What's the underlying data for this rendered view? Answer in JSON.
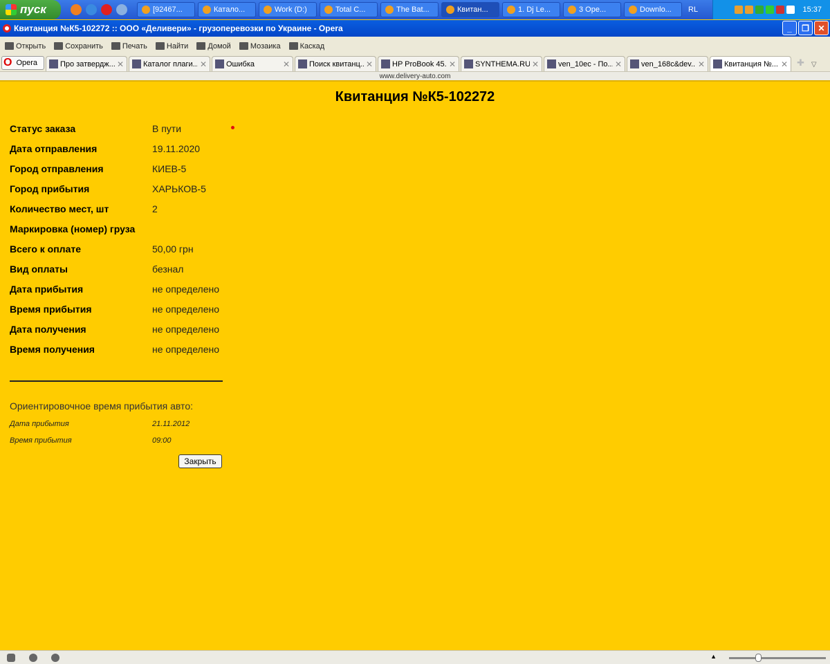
{
  "taskbar": {
    "start_label": "пуск",
    "buttons": [
      "[92467...",
      "Катало...",
      "Work (D:)",
      "Total C...",
      "The Bat...",
      "Квитан...",
      "1. Dj Le...",
      "3 Ope...",
      "Downlo..."
    ],
    "lang": "RL",
    "clock": "15:37"
  },
  "window": {
    "title": "Квитанция №К5-102272 :: ООО «Деливери» - грузоперевозки по Украине - Opera"
  },
  "toolbar": [
    "Открыть",
    "Сохранить",
    "Печать",
    "Найти",
    "Домой",
    "Мозаика",
    "Каскад"
  ],
  "opera_button": "Opera",
  "tabs": [
    "Про затвердж...",
    "Каталог плаги...",
    "Ошибка",
    "Поиск квитанц...",
    "HP ProBook 45...",
    "SYNTHEMA.RU ...",
    "ven_10ec - По...",
    "ven_168c&dev...",
    "Квитанция №..."
  ],
  "url": "www.delivery-auto.com",
  "page": {
    "heading": "Квитанция №К5-102272",
    "fields": [
      {
        "label": "Статус заказа",
        "value": "В пути"
      },
      {
        "label": "Дата отправления",
        "value": "19.11.2020"
      },
      {
        "label": "Город отправления",
        "value": "КИЕВ-5"
      },
      {
        "label": "Город прибытия",
        "value": "ХАРЬКОВ-5"
      },
      {
        "label": "Количество мест, шт",
        "value": "2"
      },
      {
        "label": "Маркировка (номер) груза",
        "value": ""
      },
      {
        "label": "Всего к оплате",
        "value": "50,00 грн"
      },
      {
        "label": "Вид оплаты",
        "value": "безнал"
      },
      {
        "label": "Дата прибытия",
        "value": "не определено"
      },
      {
        "label": "Время прибытия",
        "value": "не определено"
      },
      {
        "label": "Дата получения",
        "value": "не определено"
      },
      {
        "label": "Время получения",
        "value": "не определено"
      }
    ],
    "estimate_title": "Ориентировочное время прибытия авто:",
    "estimate": [
      {
        "label": "Дата прибытия",
        "value": "21.11.2012"
      },
      {
        "label": "Время прибытия",
        "value": "09:00"
      }
    ],
    "close_label": "Закрыть"
  },
  "zoom_slider": 0.3
}
